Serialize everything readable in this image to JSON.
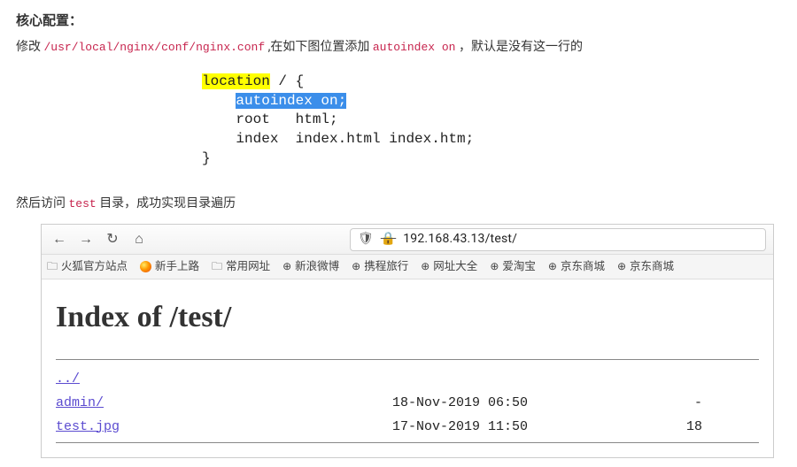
{
  "title": "核心配置：",
  "line1": {
    "pre": "修改 ",
    "code1": "/usr/local/nginx/conf/nginx.conf",
    "mid": " ,在如下图位置添加 ",
    "code2": "autoindex on",
    "post": " ，默认是没有这一行的"
  },
  "codeblock": {
    "l1a": "location",
    "l1b": " / {",
    "l2a": "    ",
    "l2b": "autoindex on;",
    "l3": "    root   html;",
    "l4": "    index  index.html index.htm;",
    "l5": "}"
  },
  "para2": {
    "pre": "然后访问 ",
    "code": "test",
    "post": " 目录，成功实现目录遍历"
  },
  "nav": {
    "back": "←",
    "fwd": "→",
    "reload": "↻",
    "home": "⌂"
  },
  "url": "192.168.43.13/test/",
  "bookmarks": {
    "b1": "火狐官方站点",
    "b2": "新手上路",
    "b3": "常用网址",
    "b4": "新浪微博",
    "b5": "携程旅行",
    "b6": "网址大全",
    "b7": "爱淘宝",
    "b8": "京东商城",
    "b9": "京东商城"
  },
  "page": {
    "heading": "Index of /test/",
    "rows": [
      {
        "name": "../",
        "date": "",
        "size": ""
      },
      {
        "name": "admin/",
        "date": "18-Nov-2019 06:50",
        "size": "-"
      },
      {
        "name": "test.jpg",
        "date": "17-Nov-2019 11:50",
        "size": "18"
      }
    ]
  }
}
